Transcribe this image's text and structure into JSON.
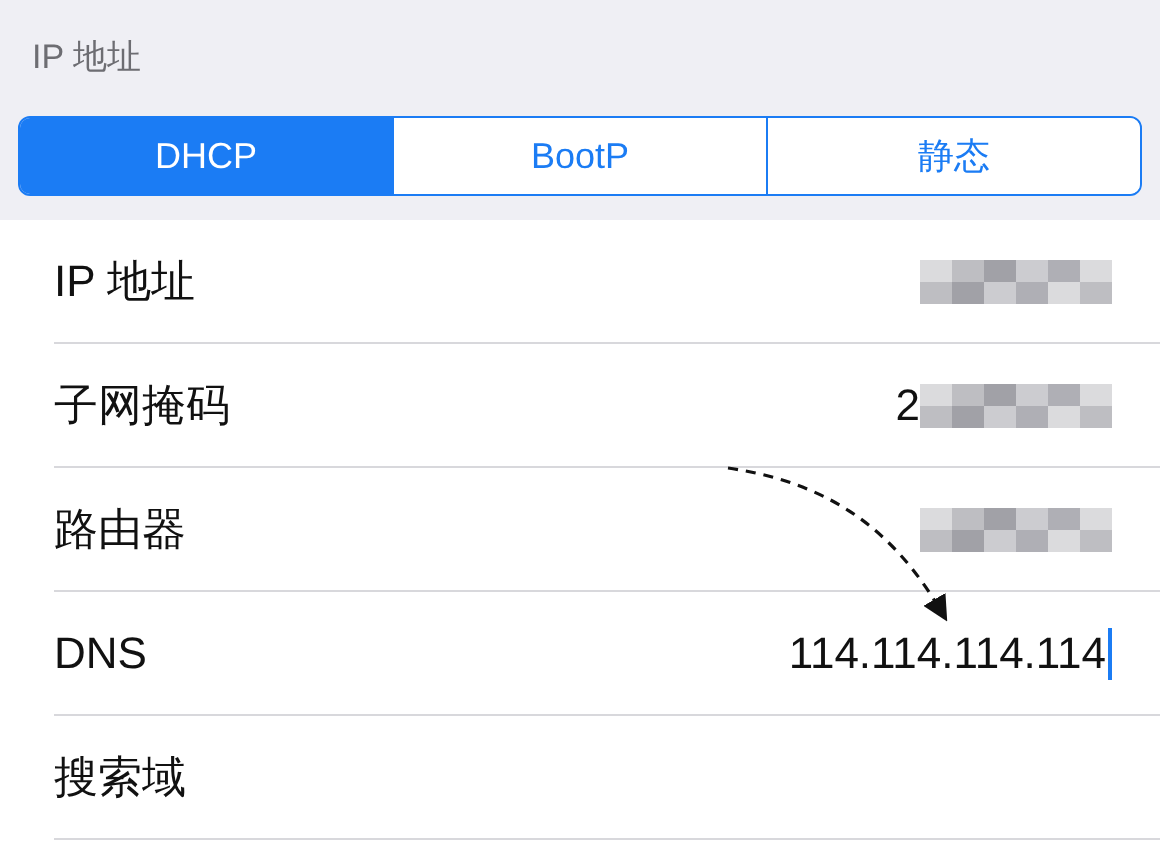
{
  "section_header": "IP 地址",
  "segments": [
    {
      "label": "DHCP",
      "selected": true
    },
    {
      "label": "BootP",
      "selected": false
    },
    {
      "label": "静态",
      "selected": false
    }
  ],
  "rows": [
    {
      "label": "IP 地址",
      "kind": "blurred",
      "editing": false
    },
    {
      "label": "子网掩码",
      "kind": "partial",
      "value": "2",
      "editing": false
    },
    {
      "label": "路由器",
      "kind": "blurred",
      "editing": false
    },
    {
      "label": "DNS",
      "kind": "text",
      "value": "114.114.114.114",
      "editing": true
    },
    {
      "label": "搜索域",
      "kind": "empty",
      "editing": false
    }
  ]
}
